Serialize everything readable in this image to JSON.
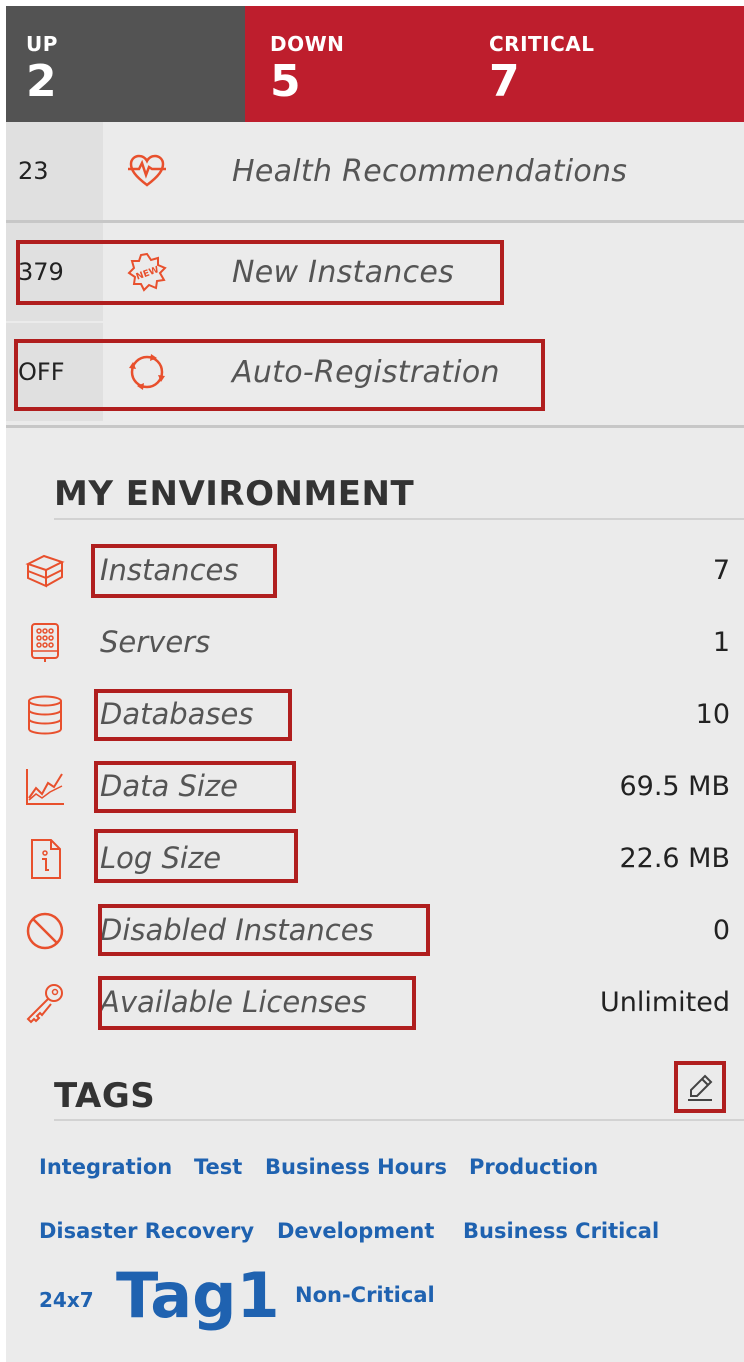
{
  "status": {
    "up": {
      "label": "UP",
      "count": "2"
    },
    "down": {
      "label": "DOWN",
      "count": "5"
    },
    "critical": {
      "label": "CRITICAL",
      "count": "7"
    }
  },
  "quick_rows": [
    {
      "count": "23",
      "label": "Health Recommendations",
      "icon": "heart-pulse-icon"
    },
    {
      "count": "379",
      "label": "New Instances",
      "icon": "new-badge-icon"
    },
    {
      "count": "OFF",
      "label": "Auto-Registration",
      "icon": "refresh-cycle-icon"
    }
  ],
  "environment": {
    "title": "MY ENVIRONMENT",
    "items": [
      {
        "label": "Instances",
        "value": "7",
        "icon": "instances-icon"
      },
      {
        "label": "Servers",
        "value": "1",
        "icon": "servers-icon"
      },
      {
        "label": "Databases",
        "value": "10",
        "icon": "database-icon"
      },
      {
        "label": "Data Size",
        "value": "69.5 MB",
        "icon": "chart-line-icon"
      },
      {
        "label": "Log Size",
        "value": "22.6 MB",
        "icon": "log-file-icon"
      },
      {
        "label": "Disabled Instances",
        "value": "0",
        "icon": "disabled-icon"
      },
      {
        "label": "Available Licenses",
        "value": "Unlimited",
        "icon": "key-icon"
      }
    ]
  },
  "tags": {
    "title": "TAGS",
    "edit_icon": "pencil-icon",
    "items": [
      "Integration",
      "Test",
      "Business Hours",
      "Production",
      "Disaster Recovery",
      "Development",
      "Business Critical",
      "24x7",
      "Tag1",
      "Non-Critical"
    ]
  },
  "colors": {
    "accent": "#e8502d",
    "alert_red": "#be1e2d",
    "up_gray": "#535353",
    "tag_blue": "#1f62b0",
    "highlight": "#b01e1e"
  }
}
